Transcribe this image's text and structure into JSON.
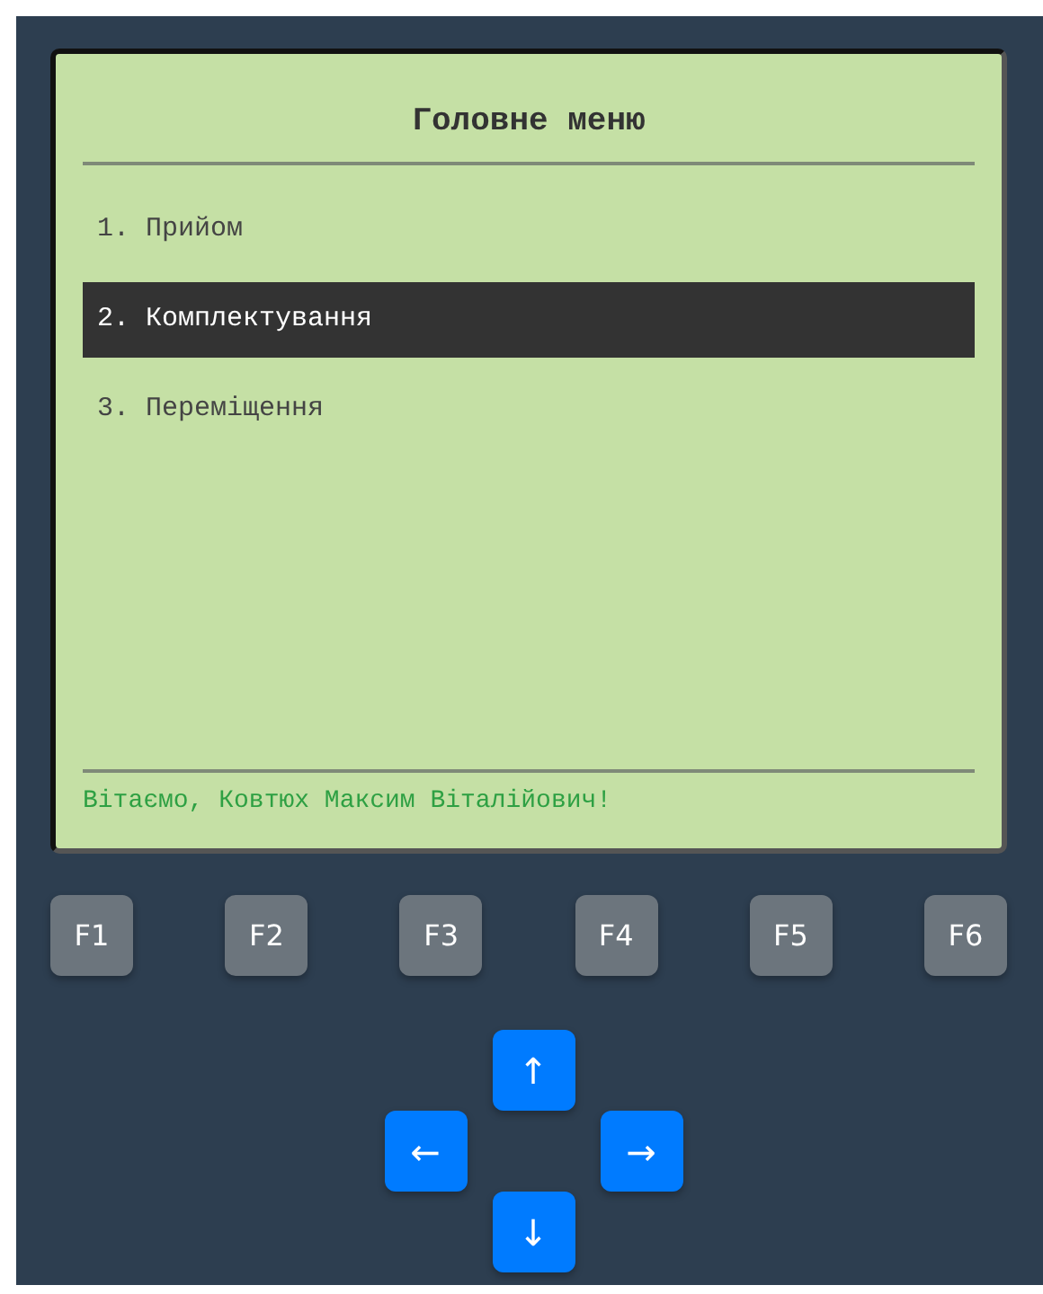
{
  "screen": {
    "title": "Головне меню",
    "menu": [
      {
        "label": "1. Прийом",
        "selected": false
      },
      {
        "label": "2. Комплектування",
        "selected": true
      },
      {
        "label": "3. Переміщення",
        "selected": false
      }
    ],
    "footer": "Вітаємо, Ковтюх Максим Віталійович!"
  },
  "function_keys": [
    "F1",
    "F2",
    "F3",
    "F4",
    "F5",
    "F6"
  ],
  "arrow_keys": [
    {
      "kind": "up",
      "label": "↑"
    },
    {
      "kind": "left",
      "label": "←"
    },
    {
      "kind": "right",
      "label": "→"
    },
    {
      "kind": "down",
      "label": "↓"
    }
  ]
}
